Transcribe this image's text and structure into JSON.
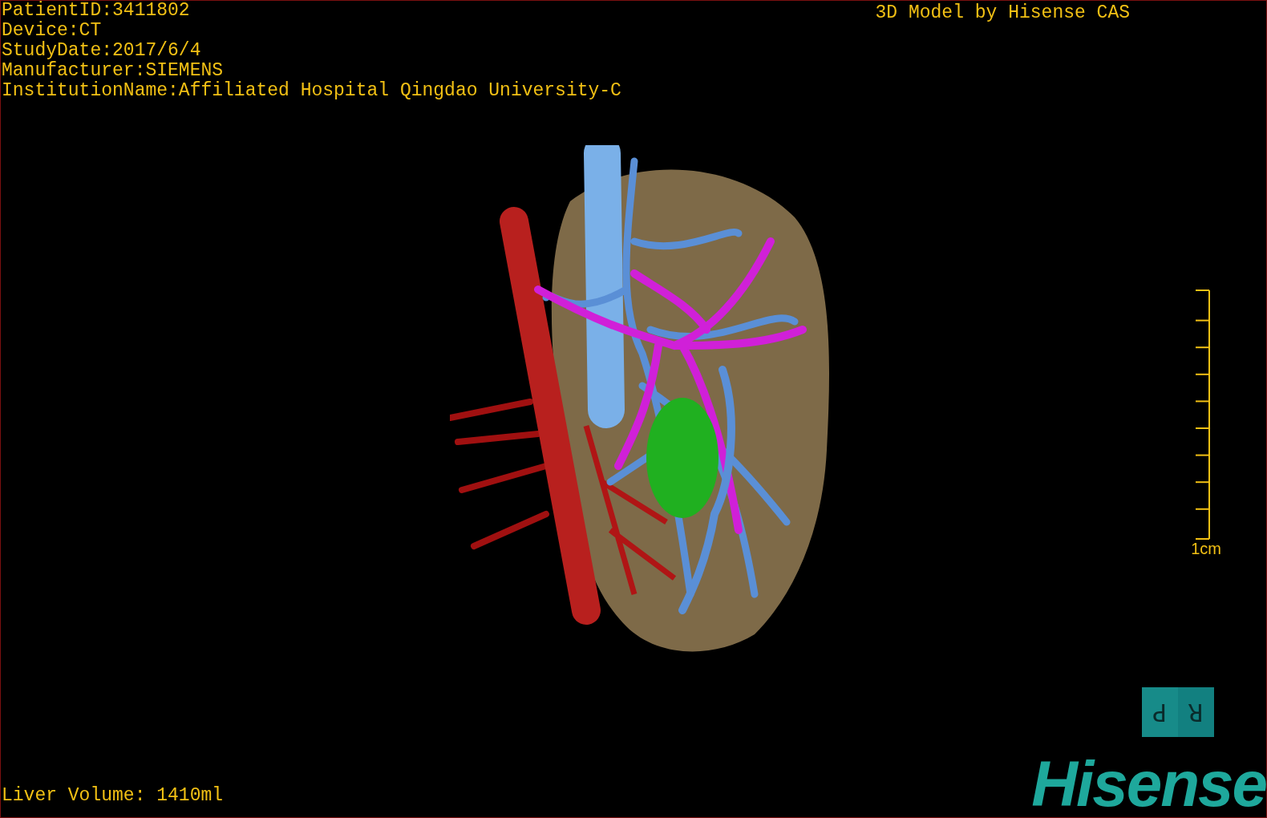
{
  "patient_info": [
    "PatientID:3411802",
    "Device:CT",
    "StudyDate:2017/6/4",
    "Manufacturer:SIEMENS",
    "InstitutionName:Affiliated Hospital Qingdao University-C"
  ],
  "title": "3D Model by Hisense CAS",
  "scale": {
    "label": "1cm"
  },
  "orientation": {
    "left": "P",
    "right": "R"
  },
  "volume": "Liver Volume: 1410ml",
  "logo": "Hisense"
}
